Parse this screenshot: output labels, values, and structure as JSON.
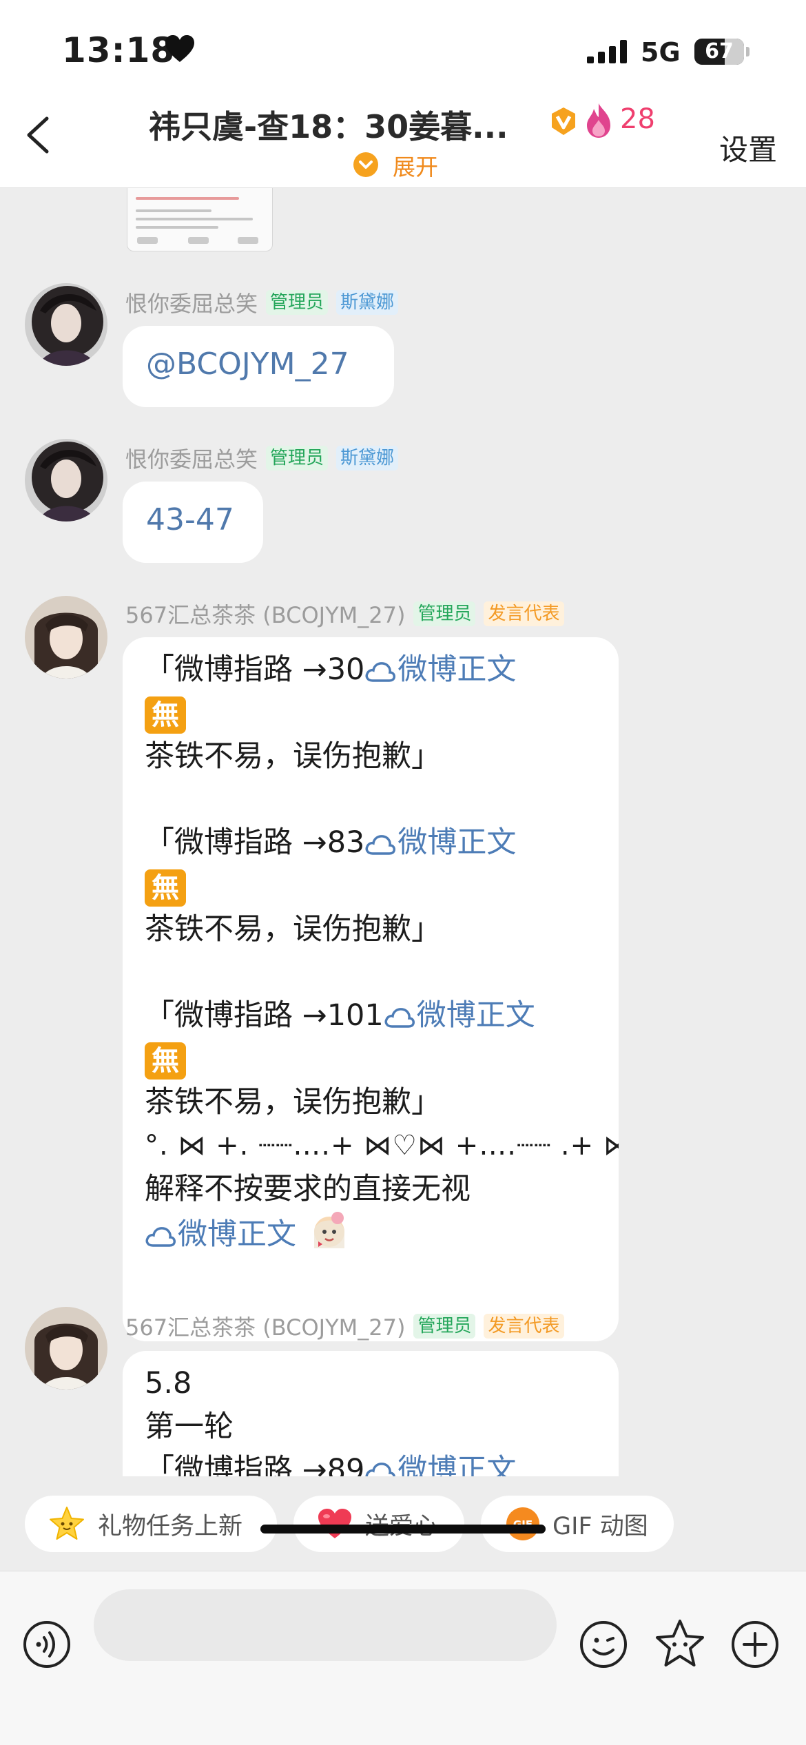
{
  "status_bar": {
    "time": "13:18",
    "network": "5G",
    "battery": "67"
  },
  "header": {
    "title": "祎只虞-查18：30姜暮...",
    "fire_count": "28",
    "expand_label": "展开",
    "settings_label": "设置"
  },
  "messages": [
    {
      "sender": "恨你委屈总笑",
      "tags": [
        "管理员",
        "斯黛娜"
      ],
      "text": "@BCOJYM_27"
    },
    {
      "sender": "恨你委屈总笑",
      "tags": [
        "管理员",
        "斯黛娜"
      ],
      "text": "43-47"
    },
    {
      "sender": "567汇总茶茶 (BCOJYM_27)",
      "tags": [
        "管理员",
        "发言代表"
      ],
      "prefix": "「微博指路 →",
      "link_label": "微博正文",
      "badge": "無",
      "apology": "茶铁不易，误伤抱歉」",
      "blocks": [
        {
          "num": "30"
        },
        {
          "num": "83"
        },
        {
          "num": "101"
        }
      ],
      "deco_line": "°. ⋈ +. ┈┈….+ ⋈♡⋈ +….┈┈ .+ ⋈.°",
      "notice": "解释不按要求的直接无视",
      "final_link": "微博正文"
    },
    {
      "sender": "567汇总茶茶 (BCOJYM_27)",
      "tags": [
        "管理员",
        "发言代表"
      ],
      "lines": [
        "5.8",
        "第一轮"
      ],
      "partial_prefix": "「微博指路 →",
      "partial_num": "89",
      "partial_link": "微博正文"
    }
  ],
  "quick_chips": [
    {
      "label": "礼物任务上新",
      "icon": "star-icon"
    },
    {
      "label": "送爱心",
      "icon": "heart-icon"
    },
    {
      "label": "GIF 动图",
      "icon": "gif-icon"
    }
  ],
  "input": {
    "placeholder": ""
  },
  "colors": {
    "link": "#4d7cb6",
    "admin_tag": "#24a65a",
    "blue_tag": "#4c98d4",
    "orange_tag": "#f39a25",
    "fire": "#ef3f6e",
    "expand": "#f08a1c"
  }
}
